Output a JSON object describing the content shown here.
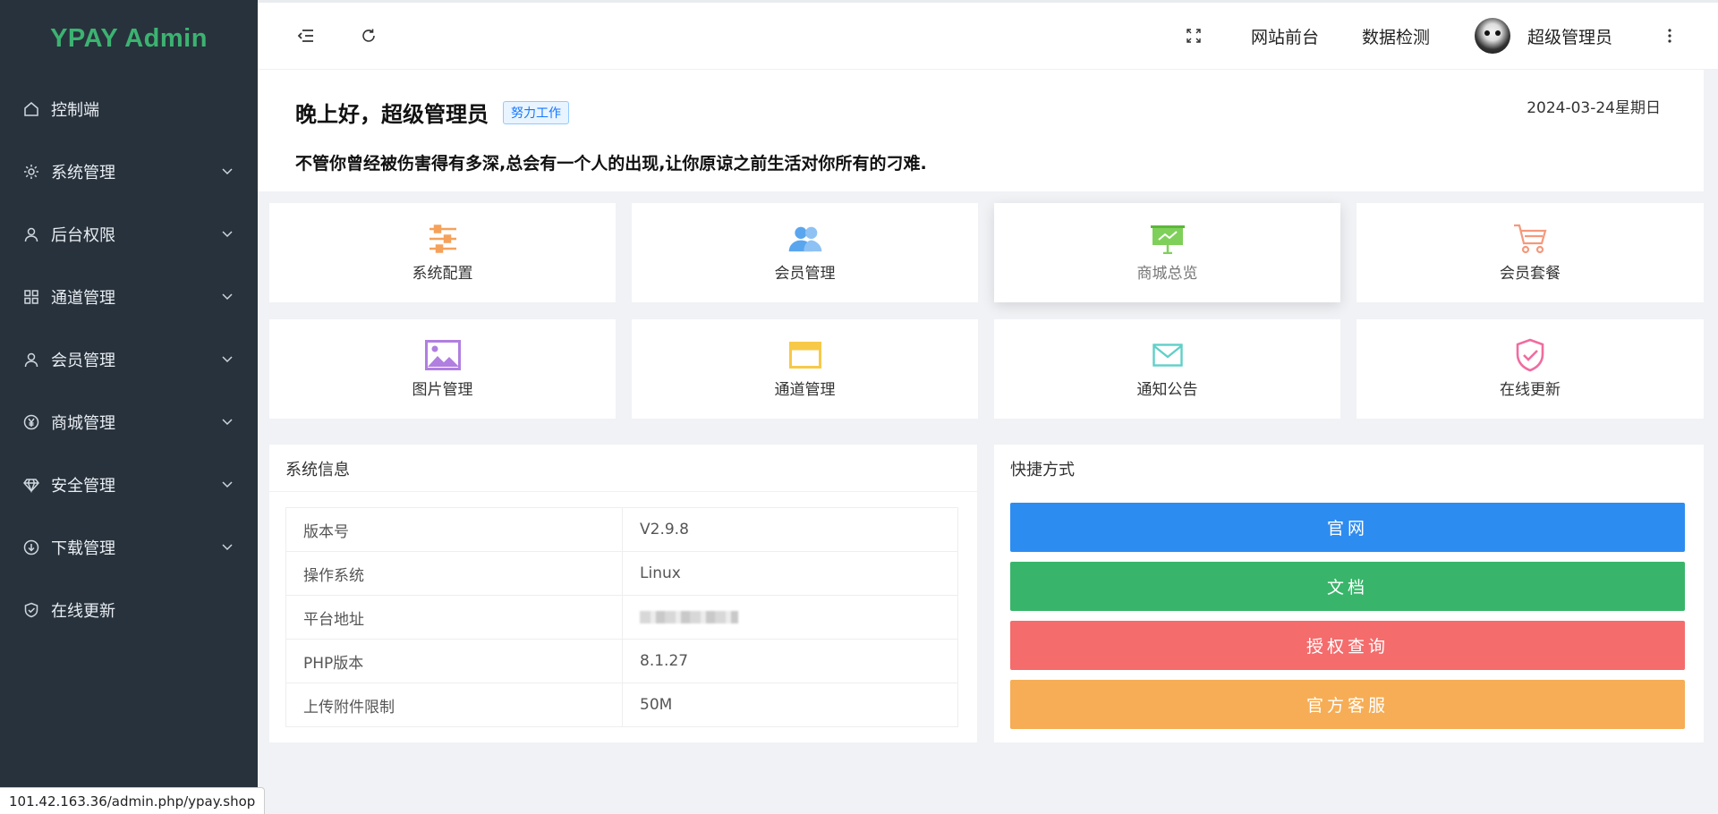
{
  "app": {
    "logo": "YPAY Admin"
  },
  "sidebar": {
    "items": [
      {
        "label": "控制端",
        "icon": "home-icon",
        "has_submenu": false
      },
      {
        "label": "系统管理",
        "icon": "gear-icon",
        "has_submenu": true
      },
      {
        "label": "后台权限",
        "icon": "user-icon",
        "has_submenu": true
      },
      {
        "label": "通道管理",
        "icon": "grid-icon",
        "has_submenu": true
      },
      {
        "label": "会员管理",
        "icon": "user-icon",
        "has_submenu": true
      },
      {
        "label": "商城管理",
        "icon": "yen-circle-icon",
        "has_submenu": true
      },
      {
        "label": "安全管理",
        "icon": "diamond-icon",
        "has_submenu": true
      },
      {
        "label": "下载管理",
        "icon": "download-circle-icon",
        "has_submenu": true
      },
      {
        "label": "在线更新",
        "icon": "shield-check-icon",
        "has_submenu": false
      }
    ]
  },
  "header": {
    "links": [
      "网站前台",
      "数据检测"
    ],
    "user_name": "超级管理员"
  },
  "welcome": {
    "greeting": "晚上好，超级管理员",
    "tag": "努力工作",
    "date": "2024-03-24星期日",
    "motto": "不管你曾经被伤害得有多深,总会有一个人的出现,让你原谅之前生活对你所有的刁难."
  },
  "tiles": [
    {
      "label": "系统配置",
      "icon": "sliders-icon",
      "color": "#f5a15a"
    },
    {
      "label": "会员管理",
      "icon": "users-icon",
      "color": "#5aa6ee"
    },
    {
      "label": "商城总览",
      "icon": "presentation-icon",
      "color": "#7fd05a"
    },
    {
      "label": "会员套餐",
      "icon": "cart-icon",
      "color": "#f39a7c"
    },
    {
      "label": "图片管理",
      "icon": "image-icon",
      "color": "#b07fe0"
    },
    {
      "label": "通道管理",
      "icon": "browser-window-icon",
      "color": "#f7c948"
    },
    {
      "label": "通知公告",
      "icon": "mail-icon",
      "color": "#5fd0c8"
    },
    {
      "label": "在线更新",
      "icon": "shield-check-icon",
      "color": "#f06ca0"
    }
  ],
  "system_info": {
    "title": "系统信息",
    "rows": [
      {
        "key": "版本号",
        "value": "V2.9.8"
      },
      {
        "key": "操作系统",
        "value": "Linux"
      },
      {
        "key": "平台地址",
        "value": ""
      },
      {
        "key": "PHP版本",
        "value": "8.1.27"
      },
      {
        "key": "上传附件限制",
        "value": "50M"
      }
    ]
  },
  "shortcuts": {
    "title": "快捷方式",
    "buttons": [
      {
        "label": "官网",
        "color": "#2d8cf0"
      },
      {
        "label": "文档",
        "color": "#38b56a"
      },
      {
        "label": "授权查询",
        "color": "#f46c6c"
      },
      {
        "label": "官方客服",
        "color": "#f6ad55"
      }
    ]
  },
  "statusbar": {
    "url": "101.42.163.36/admin.php/ypay.shop"
  }
}
